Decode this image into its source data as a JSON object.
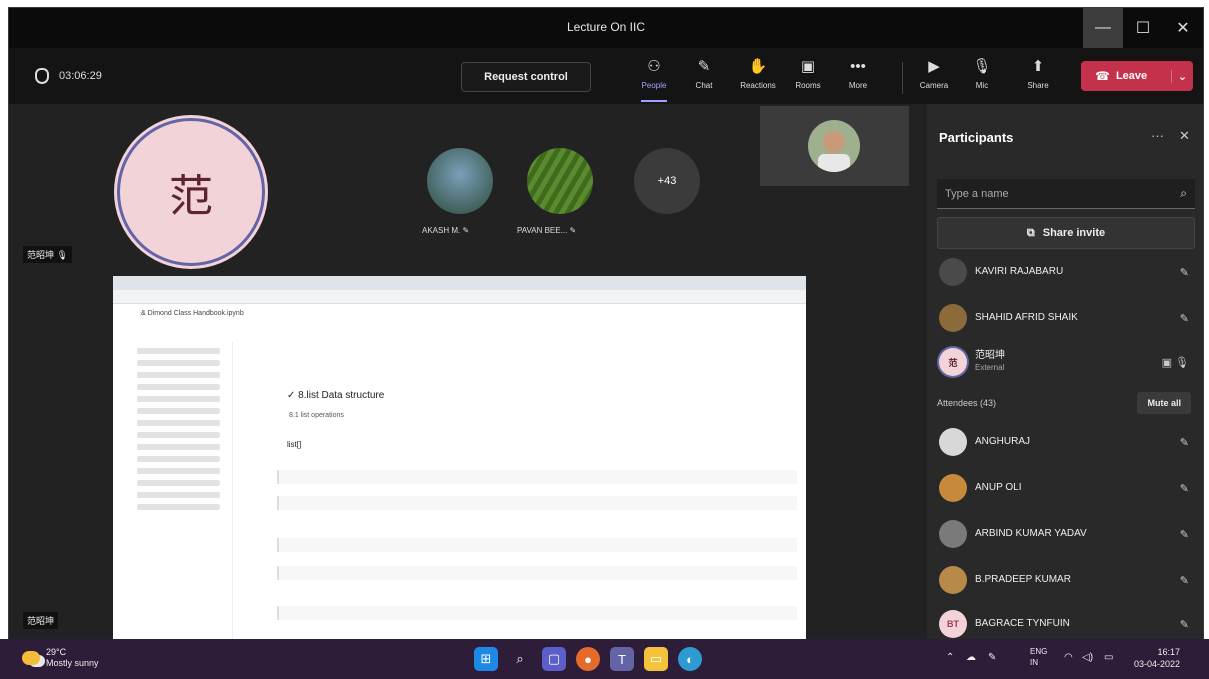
{
  "window": {
    "title": "Lecture On IIC",
    "minimize_icon": "—",
    "maximize_icon": "☐",
    "close_icon": "✕"
  },
  "toolbar": {
    "timer": "03:06:29",
    "request_control": "Request control",
    "buttons": [
      {
        "label": "People",
        "icon": "people-icon",
        "glyph": "⚇"
      },
      {
        "label": "Chat",
        "icon": "chat-icon",
        "glyph": "✎"
      },
      {
        "label": "Reactions",
        "icon": "reactions-icon",
        "glyph": "✋"
      },
      {
        "label": "Rooms",
        "icon": "rooms-icon",
        "glyph": "▣"
      },
      {
        "label": "More",
        "icon": "more-icon",
        "glyph": "•••"
      },
      {
        "label": "Camera",
        "icon": "camera-icon",
        "glyph": "▶"
      },
      {
        "label": "Mic",
        "icon": "mic-icon",
        "glyph": "🎙"
      },
      {
        "label": "Share",
        "icon": "share-icon",
        "glyph": "⬆"
      }
    ],
    "leave": "Leave",
    "leave_icon": "☎",
    "leave_chevron": "⌄"
  },
  "stage": {
    "presenter_initial": "范",
    "presenter_tag": "范昭坤",
    "bottom_tag": "范昭坤",
    "mic_glyph": "🎙",
    "participants": [
      {
        "name": "AKASH M.",
        "mic": "✎"
      },
      {
        "name": "PAVAN BEE...",
        "mic": "✎"
      }
    ],
    "more_count": "+43"
  },
  "shared_screen": {
    "doc_title": "& Dimond Class Handbook.ipynb",
    "heading": "✓ 8.list Data structure",
    "subtext": "8.1 list operations",
    "cell_text": "list[]"
  },
  "panel": {
    "title": "Participants",
    "more_icon": "···",
    "close_icon": "✕",
    "search_placeholder": "Type a name",
    "search_icon": "⌕",
    "share_invite": "Share invite",
    "share_icon": "⧉",
    "attendees_label": "Attendees (43)",
    "mute_all": "Mute all",
    "presenters": [
      {
        "name": "KAVIRI RAJABARU",
        "sub": ""
      },
      {
        "name": "SHAHID AFRID SHAIK",
        "sub": ""
      },
      {
        "name": "范昭坤",
        "sub": "External"
      }
    ],
    "attendees": [
      {
        "name": "ANGHURAJ"
      },
      {
        "name": "ANUP OLI"
      },
      {
        "name": "ARBIND KUMAR YADAV"
      },
      {
        "name": "B.PRADEEP KUMAR"
      },
      {
        "name": "BAGRACE TYNFUIN",
        "initials": "BT"
      }
    ],
    "mic_muted_glyph": "✎"
  },
  "taskbar": {
    "temp": "29°C",
    "condition": "Mostly sunny",
    "lang": "ENG",
    "region": "IN",
    "time": "16:17",
    "date": "03-04-2022"
  }
}
